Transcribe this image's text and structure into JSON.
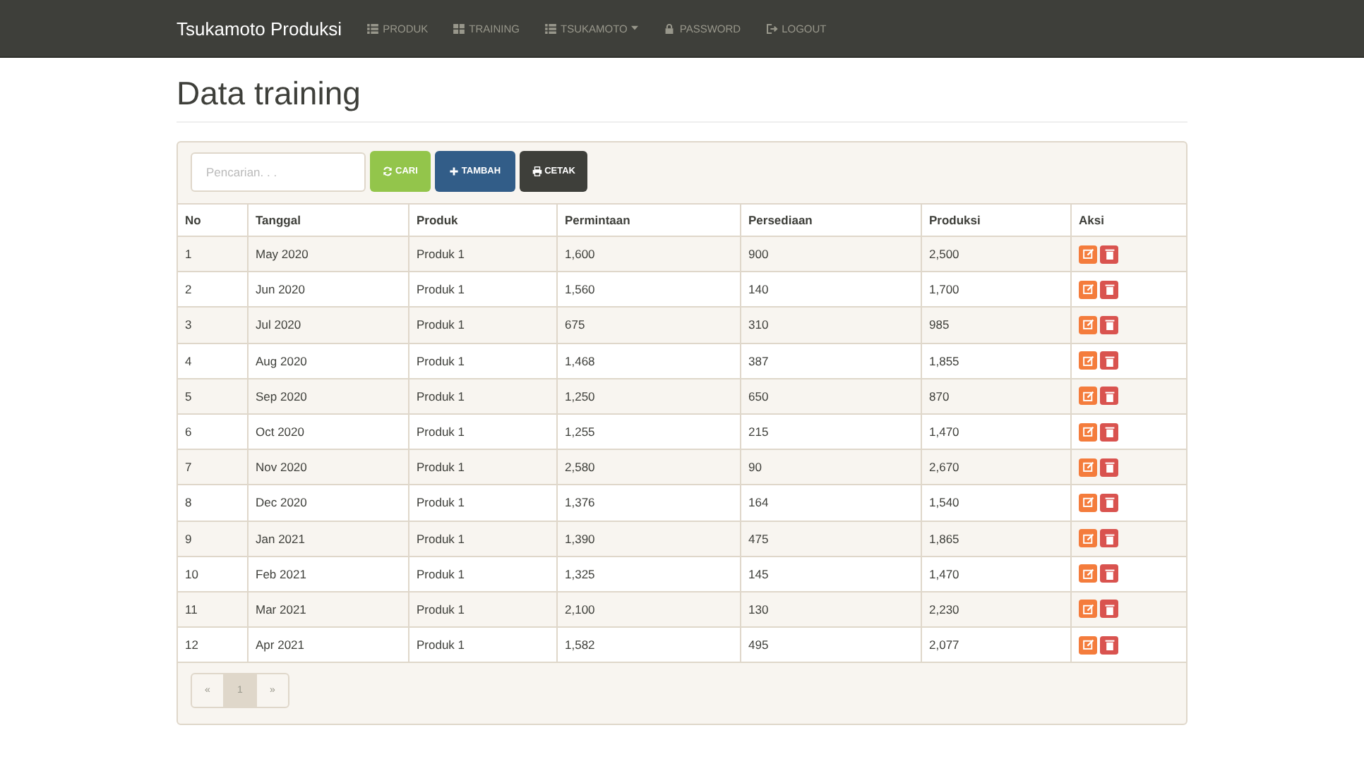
{
  "navbar": {
    "brand": "Tsukamoto Produksi",
    "items": [
      {
        "label": "PRODUK",
        "kind": "list",
        "dropdown": false
      },
      {
        "label": "TRAINING",
        "kind": "grid",
        "dropdown": false
      },
      {
        "label": "TSUKAMOTO",
        "kind": "list",
        "dropdown": true
      },
      {
        "label": "PASSWORD",
        "kind": "lock",
        "dropdown": false
      },
      {
        "label": "LOGOUT",
        "kind": "logout",
        "dropdown": false
      }
    ]
  },
  "page_title": "Data training",
  "toolbar": {
    "search": {
      "placeholder": "Pencarian. . ."
    },
    "buttons": [
      {
        "label": "CARI",
        "kind": "search"
      },
      {
        "label": "TAMBAH",
        "kind": "add"
      },
      {
        "label": "CETAK",
        "kind": "print"
      }
    ]
  },
  "table": {
    "columns": [
      "No",
      "Tanggal",
      "Produk",
      "Permintaan",
      "Persediaan",
      "Produksi",
      "Aksi"
    ],
    "rows": [
      [
        "1",
        "May 2020",
        "Produk 1",
        "1,600",
        "900",
        "2,500"
      ],
      [
        "2",
        "Jun 2020",
        "Produk 1",
        "1,560",
        "140",
        "1,700"
      ],
      [
        "3",
        "Jul 2020",
        "Produk 1",
        "675",
        "310",
        "985"
      ],
      [
        "4",
        "Aug 2020",
        "Produk 1",
        "1,468",
        "387",
        "1,855"
      ],
      [
        "5",
        "Sep 2020",
        "Produk 1",
        "1,250",
        "650",
        "870"
      ],
      [
        "6",
        "Oct 2020",
        "Produk 1",
        "1,255",
        "215",
        "1,470"
      ],
      [
        "7",
        "Nov 2020",
        "Produk 1",
        "2,580",
        "90",
        "2,670"
      ],
      [
        "8",
        "Dec 2020",
        "Produk 1",
        "1,376",
        "164",
        "1,540"
      ],
      [
        "9",
        "Jan 2021",
        "Produk 1",
        "1,390",
        "475",
        "1,865"
      ],
      [
        "10",
        "Feb 2021",
        "Produk 1",
        "1,325",
        "145",
        "1,470"
      ],
      [
        "11",
        "Mar 2021",
        "Produk 1",
        "2,100",
        "130",
        "2,230"
      ],
      [
        "12",
        "Apr 2021",
        "Produk 1",
        "1,582",
        "495",
        "2,077"
      ]
    ]
  },
  "pagination": [
    {
      "label": "«",
      "selected": false
    },
    {
      "label": "1",
      "selected": true
    },
    {
      "label": "»",
      "selected": false
    }
  ]
}
